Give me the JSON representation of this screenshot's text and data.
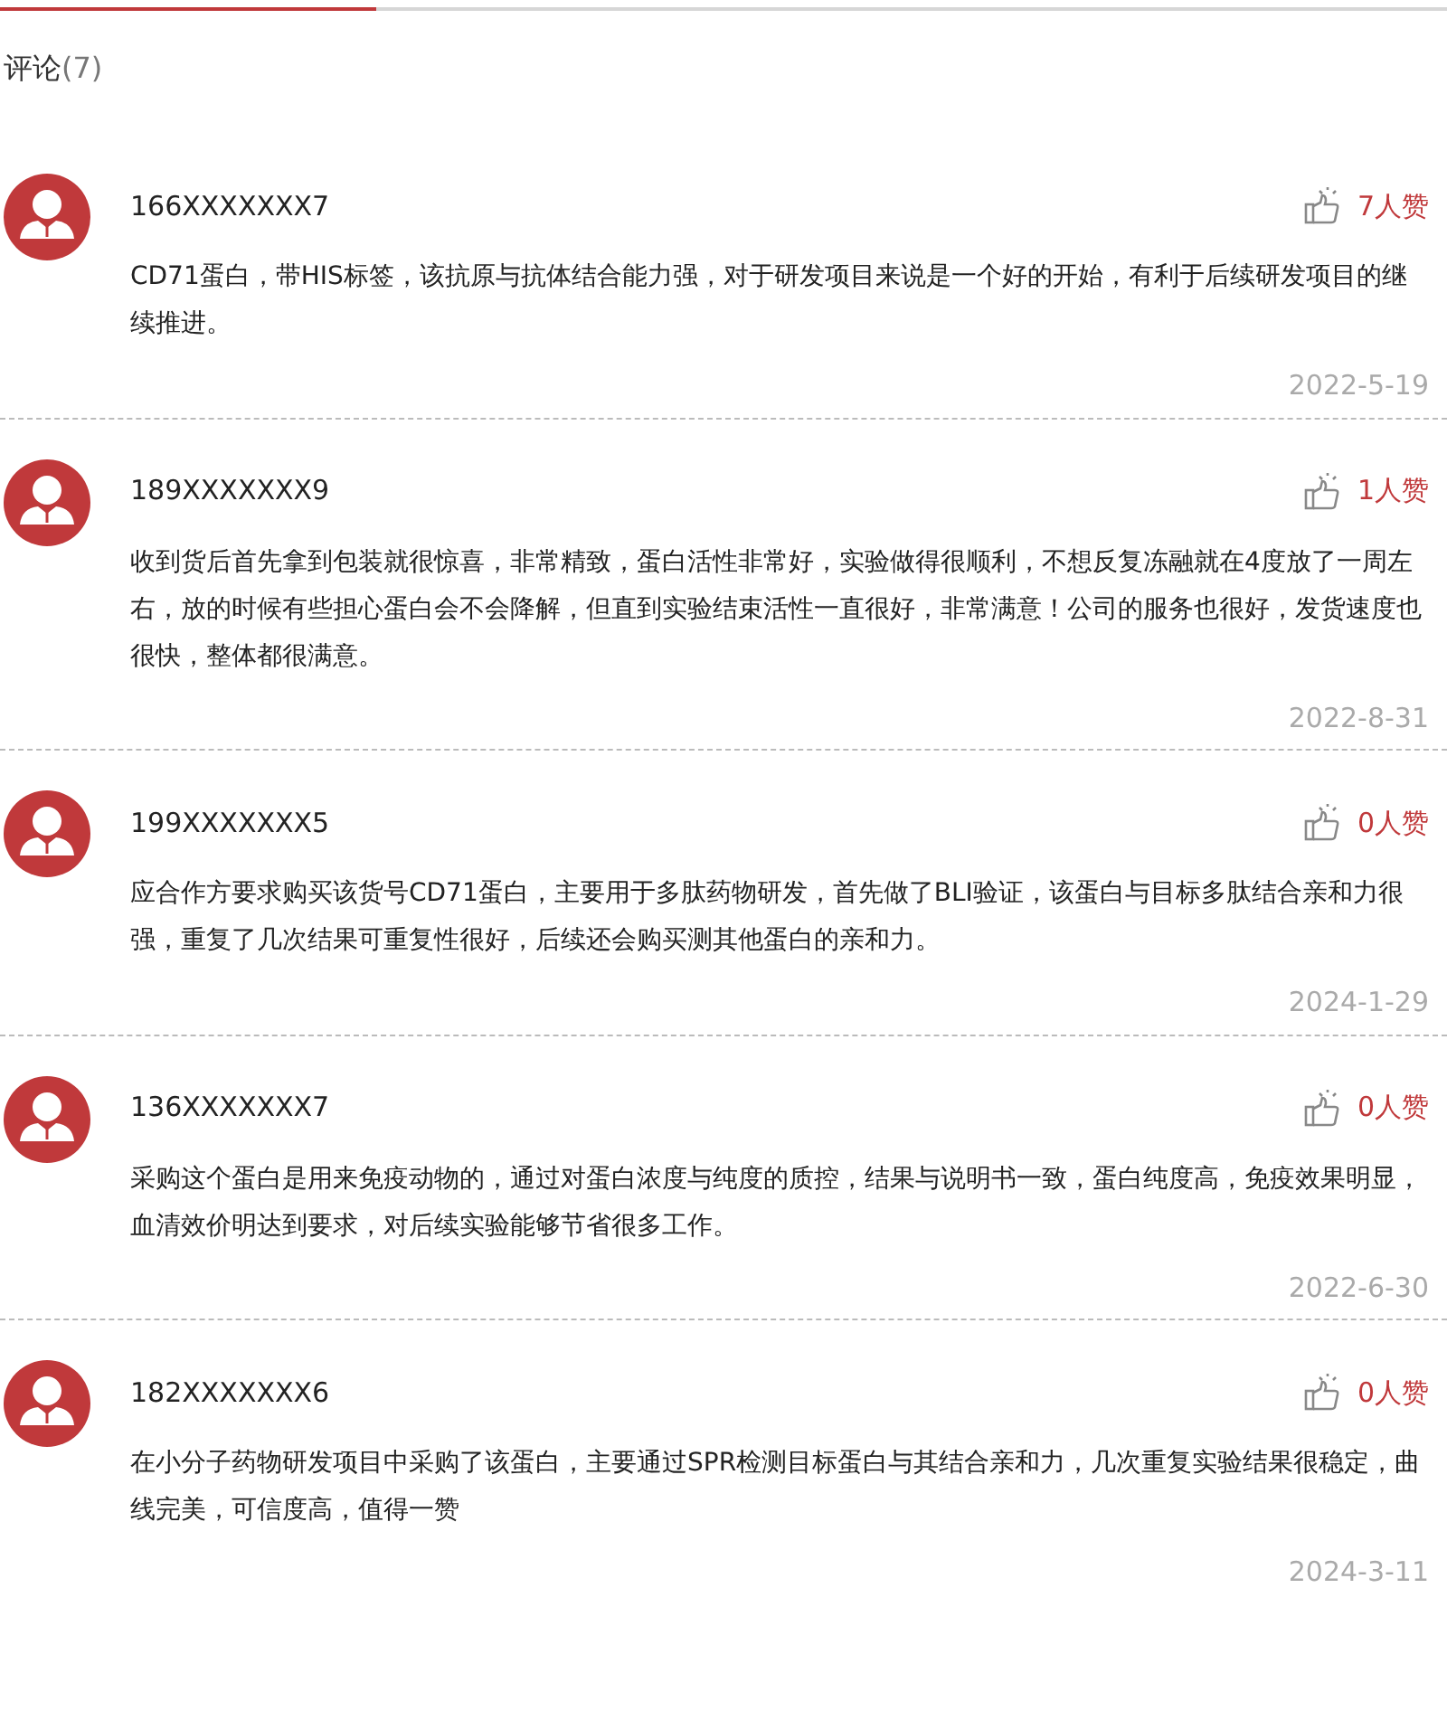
{
  "comments_header": {
    "title": "评论",
    "count": "(7)"
  },
  "comments": [
    {
      "user": "166XXXXXXX7",
      "likes": "7人赞",
      "text": "CD71蛋白，带HIS标签，该抗原与抗体结合能力强，对于研发项目来说是一个好的开始，有利于后续研发项目的继续推进。",
      "date": "2022-5-19"
    },
    {
      "user": "189XXXXXXX9",
      "likes": "1人赞",
      "text": "收到货后首先拿到包装就很惊喜，非常精致，蛋白活性非常好，实验做得很顺利，不想反复冻融就在4度放了一周左右，放的时候有些担心蛋白会不会降解，但直到实验结束活性一直很好，非常满意！公司的服务也很好，发货速度也很快，整体都很满意。",
      "date": "2022-8-31"
    },
    {
      "user": "199XXXXXXX5",
      "likes": "0人赞",
      "text": "应合作方要求购买该货号CD71蛋白，主要用于多肽药物研发，首先做了BLI验证，该蛋白与目标多肽结合亲和力很强，重复了几次结果可重复性很好，后续还会购买测其他蛋白的亲和力。",
      "date": "2024-1-29"
    },
    {
      "user": "136XXXXXXX7",
      "likes": "0人赞",
      "text": "采购这个蛋白是用来免疫动物的，通过对蛋白浓度与纯度的质控，结果与说明书一致，蛋白纯度高，免疫效果明显，血清效价明达到要求，对后续实验能够节省很多工作。",
      "date": "2022-6-30"
    },
    {
      "user": "182XXXXXXX6",
      "likes": "0人赞",
      "text": "在小分子药物研发项目中采购了该蛋白，主要通过SPR检测目标蛋白与其结合亲和力，几次重复实验结果很稳定，曲线完美，可信度高，值得一赞",
      "date": "2024-3-11"
    }
  ]
}
